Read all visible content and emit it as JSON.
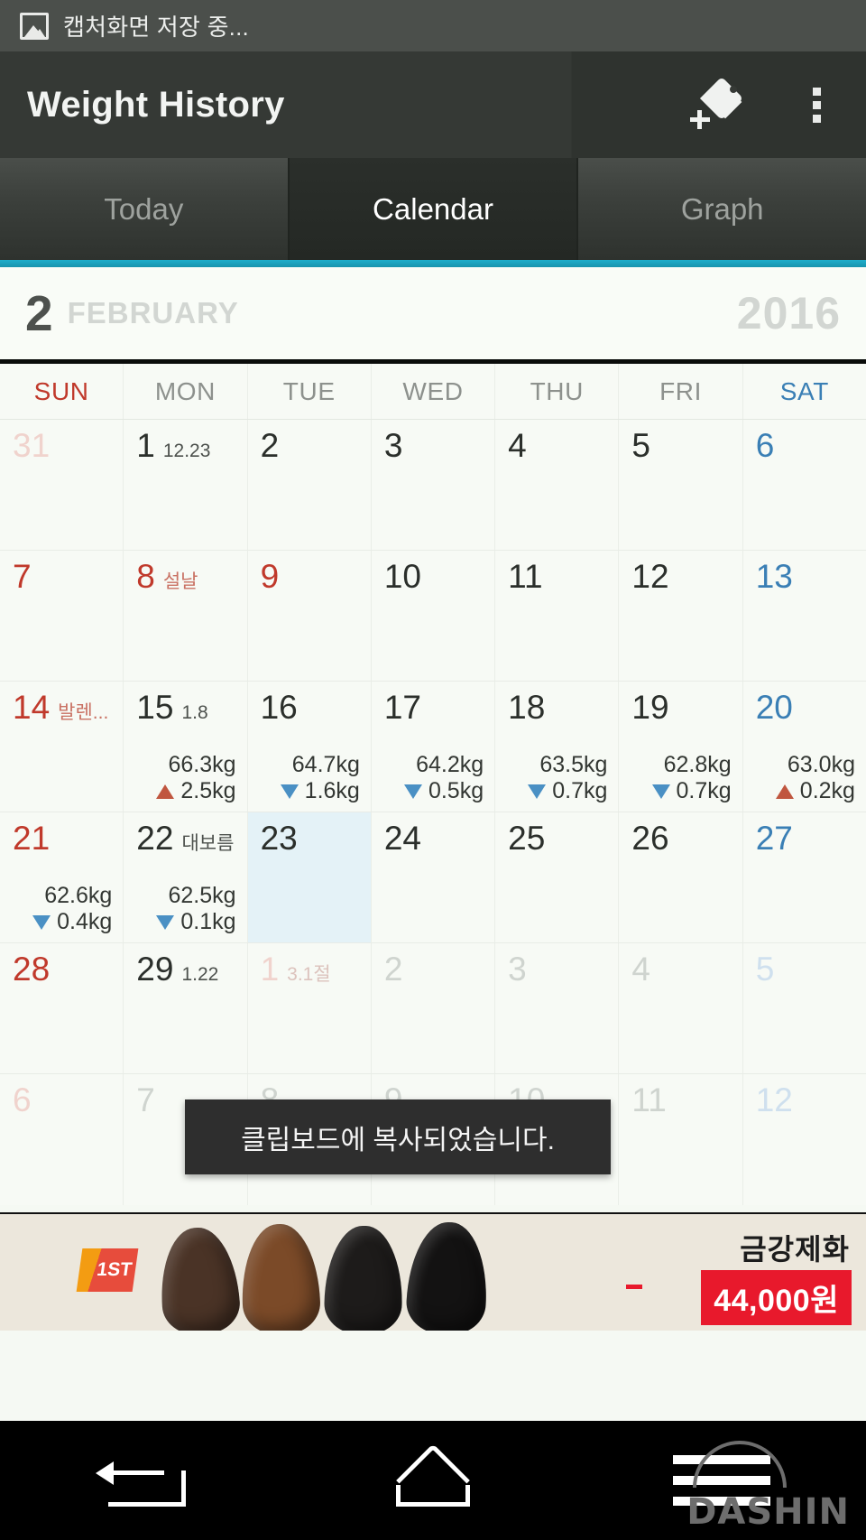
{
  "status_bar": {
    "icon": "screenshot-image-icon",
    "text": "캡처화면 저장 중..."
  },
  "action_bar": {
    "title": "Weight History",
    "add_tag_icon": "tag-plus-icon",
    "overflow_icon": "overflow-menu-icon"
  },
  "tabs": [
    {
      "label": "Today",
      "active": false
    },
    {
      "label": "Calendar",
      "active": true
    },
    {
      "label": "Graph",
      "active": false
    }
  ],
  "accent_color": "#1eaecb",
  "month_header": {
    "month_number": "2",
    "month_name": "FEBRUARY",
    "year": "2016"
  },
  "weekdays": [
    {
      "label": "SUN",
      "type": "sun"
    },
    {
      "label": "MON",
      "type": "weekday"
    },
    {
      "label": "TUE",
      "type": "weekday"
    },
    {
      "label": "WED",
      "type": "weekday"
    },
    {
      "label": "THU",
      "type": "weekday"
    },
    {
      "label": "FRI",
      "type": "weekday"
    },
    {
      "label": "SAT",
      "type": "sat"
    }
  ],
  "colors": {
    "gain_arrow": "#c0563f",
    "loss_arrow": "#4a90c4",
    "sunday": "#c0392b",
    "saturday": "#3a7fb5",
    "today_bg": "#e4f2f7"
  },
  "weeks": [
    [
      {
        "day": "31",
        "style": "out-sun",
        "label": "",
        "weight": "",
        "delta": "",
        "dir": "",
        "today": false
      },
      {
        "day": "1",
        "style": "normal",
        "label": "12.23",
        "weight": "",
        "delta": "",
        "dir": "",
        "today": false
      },
      {
        "day": "2",
        "style": "normal",
        "label": "",
        "weight": "",
        "delta": "",
        "dir": "",
        "today": false
      },
      {
        "day": "3",
        "style": "normal",
        "label": "",
        "weight": "",
        "delta": "",
        "dir": "",
        "today": false
      },
      {
        "day": "4",
        "style": "normal",
        "label": "",
        "weight": "",
        "delta": "",
        "dir": "",
        "today": false
      },
      {
        "day": "5",
        "style": "normal",
        "label": "",
        "weight": "",
        "delta": "",
        "dir": "",
        "today": false
      },
      {
        "day": "6",
        "style": "sat",
        "label": "",
        "weight": "",
        "delta": "",
        "dir": "",
        "today": false
      }
    ],
    [
      {
        "day": "7",
        "style": "sun",
        "label": "",
        "weight": "",
        "delta": "",
        "dir": "",
        "today": false
      },
      {
        "day": "8",
        "style": "hol",
        "label": "설날",
        "label_style": "hol",
        "weight": "",
        "delta": "",
        "dir": "",
        "today": false
      },
      {
        "day": "9",
        "style": "hol",
        "label": "",
        "weight": "",
        "delta": "",
        "dir": "",
        "today": false
      },
      {
        "day": "10",
        "style": "normal",
        "label": "",
        "weight": "",
        "delta": "",
        "dir": "",
        "today": false
      },
      {
        "day": "11",
        "style": "normal",
        "label": "",
        "weight": "",
        "delta": "",
        "dir": "",
        "today": false
      },
      {
        "day": "12",
        "style": "normal",
        "label": "",
        "weight": "",
        "delta": "",
        "dir": "",
        "today": false
      },
      {
        "day": "13",
        "style": "sat",
        "label": "",
        "weight": "",
        "delta": "",
        "dir": "",
        "today": false
      }
    ],
    [
      {
        "day": "14",
        "style": "sun",
        "label": "발렌...",
        "label_style": "hol",
        "weight": "",
        "delta": "",
        "dir": "",
        "today": false
      },
      {
        "day": "15",
        "style": "normal",
        "label": "1.8",
        "weight": "66.3kg",
        "delta": "2.5kg",
        "dir": "up",
        "today": false
      },
      {
        "day": "16",
        "style": "normal",
        "label": "",
        "weight": "64.7kg",
        "delta": "1.6kg",
        "dir": "down",
        "today": false
      },
      {
        "day": "17",
        "style": "normal",
        "label": "",
        "weight": "64.2kg",
        "delta": "0.5kg",
        "dir": "down",
        "today": false
      },
      {
        "day": "18",
        "style": "normal",
        "label": "",
        "weight": "63.5kg",
        "delta": "0.7kg",
        "dir": "down",
        "today": false
      },
      {
        "day": "19",
        "style": "normal",
        "label": "",
        "weight": "62.8kg",
        "delta": "0.7kg",
        "dir": "down",
        "today": false
      },
      {
        "day": "20",
        "style": "sat",
        "label": "",
        "weight": "63.0kg",
        "delta": "0.2kg",
        "dir": "up",
        "today": false
      }
    ],
    [
      {
        "day": "21",
        "style": "sun",
        "label": "",
        "weight": "62.6kg",
        "delta": "0.4kg",
        "dir": "down",
        "today": false
      },
      {
        "day": "22",
        "style": "normal",
        "label": "대보름",
        "weight": "62.5kg",
        "delta": "0.1kg",
        "dir": "down",
        "today": false
      },
      {
        "day": "23",
        "style": "normal",
        "label": "",
        "weight": "",
        "delta": "",
        "dir": "",
        "today": true
      },
      {
        "day": "24",
        "style": "normal",
        "label": "",
        "weight": "",
        "delta": "",
        "dir": "",
        "today": false
      },
      {
        "day": "25",
        "style": "normal",
        "label": "",
        "weight": "",
        "delta": "",
        "dir": "",
        "today": false
      },
      {
        "day": "26",
        "style": "normal",
        "label": "",
        "weight": "",
        "delta": "",
        "dir": "",
        "today": false
      },
      {
        "day": "27",
        "style": "sat",
        "label": "",
        "weight": "",
        "delta": "",
        "dir": "",
        "today": false
      }
    ],
    [
      {
        "day": "28",
        "style": "sun",
        "label": "",
        "weight": "",
        "delta": "",
        "dir": "",
        "today": false
      },
      {
        "day": "29",
        "style": "normal",
        "label": "1.22",
        "weight": "",
        "delta": "",
        "dir": "",
        "today": false
      },
      {
        "day": "1",
        "style": "out-sun",
        "label": "3.1절",
        "label_style": "out",
        "weight": "",
        "delta": "",
        "dir": "",
        "today": false
      },
      {
        "day": "2",
        "style": "out",
        "label": "",
        "weight": "",
        "delta": "",
        "dir": "",
        "today": false
      },
      {
        "day": "3",
        "style": "out",
        "label": "",
        "weight": "",
        "delta": "",
        "dir": "",
        "today": false
      },
      {
        "day": "4",
        "style": "out",
        "label": "",
        "weight": "",
        "delta": "",
        "dir": "",
        "today": false
      },
      {
        "day": "5",
        "style": "out-sat",
        "label": "",
        "weight": "",
        "delta": "",
        "dir": "",
        "today": false
      }
    ],
    [
      {
        "day": "6",
        "style": "out-sun",
        "label": "",
        "weight": "",
        "delta": "",
        "dir": "",
        "today": false
      },
      {
        "day": "7",
        "style": "out",
        "label": "",
        "weight": "",
        "delta": "",
        "dir": "",
        "today": false
      },
      {
        "day": "8",
        "style": "out",
        "label": "",
        "weight": "",
        "delta": "",
        "dir": "",
        "today": false
      },
      {
        "day": "9",
        "style": "out",
        "label": "",
        "weight": "",
        "delta": "",
        "dir": "",
        "today": false
      },
      {
        "day": "10",
        "style": "out",
        "label": "",
        "weight": "",
        "delta": "",
        "dir": "",
        "today": false
      },
      {
        "day": "11",
        "style": "out",
        "label": "",
        "weight": "",
        "delta": "",
        "dir": "",
        "today": false
      },
      {
        "day": "12",
        "style": "out-sat",
        "label": "",
        "weight": "",
        "delta": "",
        "dir": "",
        "today": false
      }
    ]
  ],
  "toast": {
    "message": "클립보드에 복사되었습니다."
  },
  "ad": {
    "badge": "1ST",
    "brand": "금강제화",
    "price": "44,000원"
  },
  "nav_bar": {
    "back_icon": "back-arrow-icon",
    "home_icon": "home-icon",
    "recents_icon": "menu-icon",
    "watermark": "DASHIN"
  }
}
